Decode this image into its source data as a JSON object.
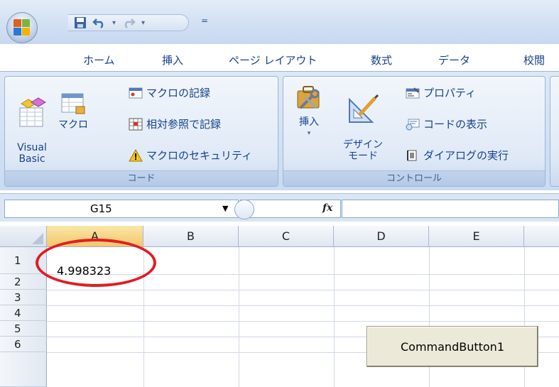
{
  "quick_access": {
    "more_symbol": "="
  },
  "tabs": [
    "ホーム",
    "挿入",
    "ページ レイアウト",
    "数式",
    "データ",
    "校閲"
  ],
  "ribbon": {
    "code_group": {
      "label": "コード",
      "visual_basic": "Visual\nBasic",
      "macro": "マクロ",
      "record_macro": "マクロの記録",
      "relative_ref": "相対参照で記録",
      "macro_security": "マクロのセキュリティ"
    },
    "controls_group": {
      "label": "コントロール",
      "insert": "挿入",
      "design_mode": "デザイン\nモード",
      "properties": "プロパティ",
      "view_code": "コードの表示",
      "run_dialog": "ダイアログの実行"
    }
  },
  "formula_bar": {
    "name_box": "G15",
    "fx": "fx",
    "formula": ""
  },
  "sheet": {
    "columns": [
      "A",
      "B",
      "C",
      "D",
      "E"
    ],
    "selected_column": "A",
    "rows": [
      "1",
      "2",
      "3",
      "4",
      "5",
      "6"
    ],
    "cells": {
      "A1": "4.998323"
    }
  },
  "command_button": {
    "label": "CommandButton1"
  },
  "colors": {
    "ribbon_text": "#15428b",
    "highlight": "#e31b23",
    "button_face": "#ece9d8"
  }
}
